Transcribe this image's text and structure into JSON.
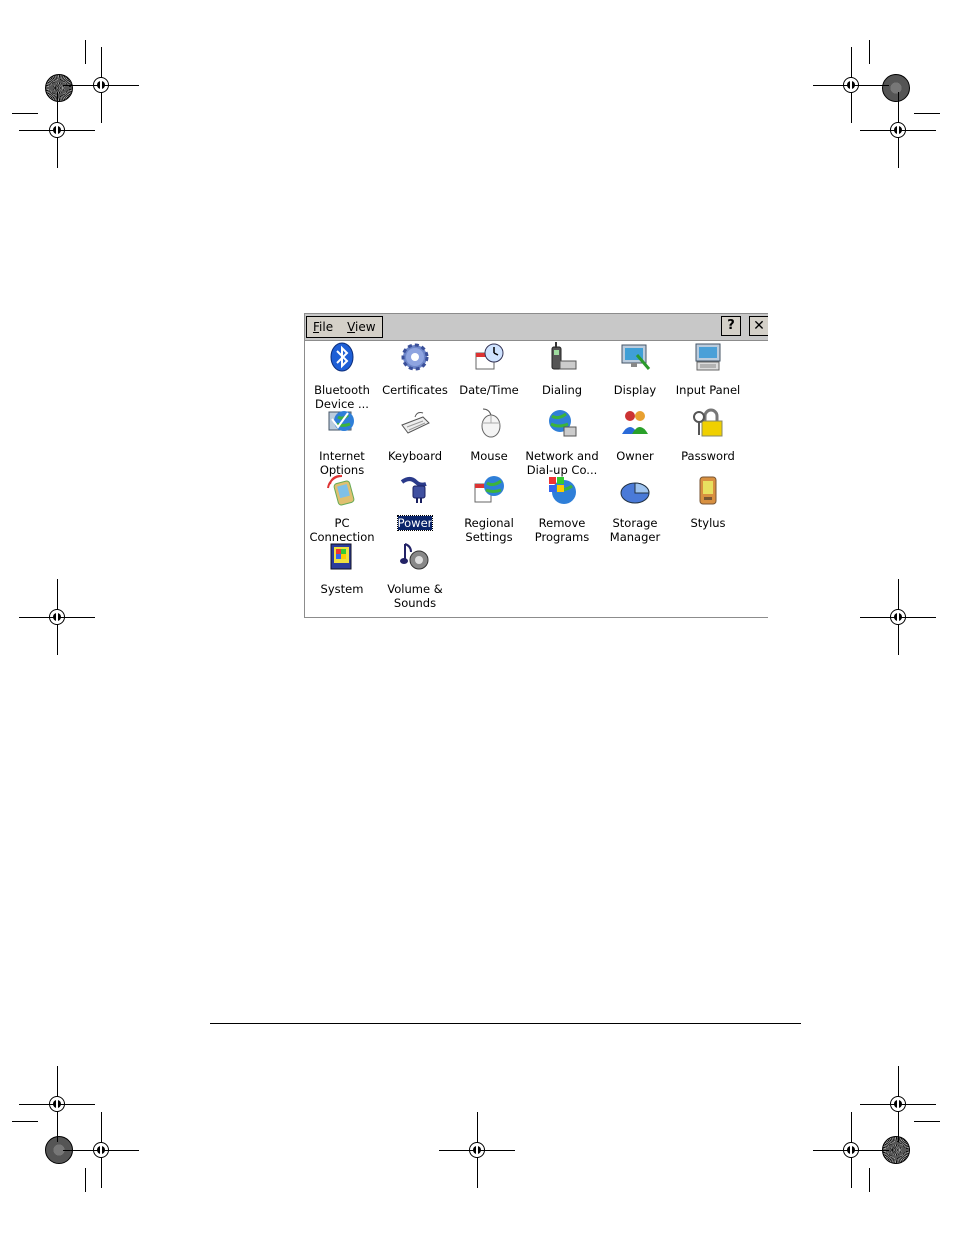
{
  "window": {
    "menu": [
      {
        "label": "File",
        "underline": "F",
        "rest": "ile"
      },
      {
        "label": "View",
        "underline": "V",
        "rest": "iew"
      }
    ],
    "help_label": "?",
    "close_label": "✕"
  },
  "items": [
    {
      "label": "Bluetooth\nDevice ...",
      "icon": "bluetooth-icon"
    },
    {
      "label": "Certificates",
      "icon": "gear-icon"
    },
    {
      "label": "Date/Time",
      "icon": "clock-calendar-icon"
    },
    {
      "label": "Dialing",
      "icon": "phone-icon"
    },
    {
      "label": "Display",
      "icon": "monitor-icon"
    },
    {
      "label": "Input Panel",
      "icon": "keyboard-monitor-icon"
    },
    {
      "label": "Internet\nOptions",
      "icon": "globe-monitor-icon"
    },
    {
      "label": "Keyboard",
      "icon": "keyboard-icon"
    },
    {
      "label": "Mouse",
      "icon": "mouse-icon"
    },
    {
      "label": "Network and\nDial-up Co...",
      "icon": "network-globe-icon"
    },
    {
      "label": "Owner",
      "icon": "people-icon"
    },
    {
      "label": "Password",
      "icon": "padlock-keys-icon"
    },
    {
      "label": "PC\nConnection",
      "icon": "pda-signal-icon"
    },
    {
      "label": "Power",
      "icon": "power-plug-icon",
      "selected": true
    },
    {
      "label": "Regional\nSettings",
      "icon": "globe-calendar-icon"
    },
    {
      "label": "Remove\nPrograms",
      "icon": "windows-globe-icon"
    },
    {
      "label": "Storage\nManager",
      "icon": "pie-disk-icon"
    },
    {
      "label": "Stylus",
      "icon": "pda-icon"
    },
    {
      "label": "System",
      "icon": "system-book-icon"
    },
    {
      "label": "Volume &\nSounds",
      "icon": "speaker-note-icon"
    }
  ],
  "colors": {
    "selection": "#0a246a",
    "titlebar": "#c8c8c8"
  }
}
